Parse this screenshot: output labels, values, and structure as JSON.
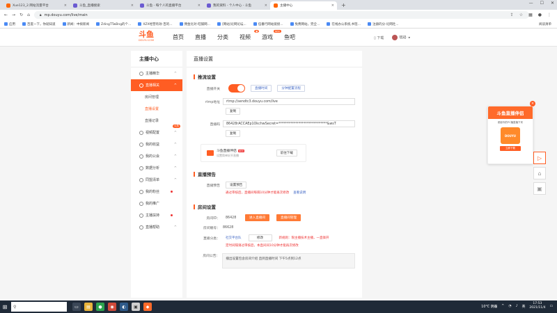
{
  "browser": {
    "tabs": [
      {
        "label": "Xue123_2.网站流量平台",
        "color": "#ff6600"
      },
      {
        "label": "斗鱼_直播搜索",
        "color": "#6b5bd1"
      },
      {
        "label": "斗鱼 - 每个人的直播平台",
        "color": "#6b5bd1"
      },
      {
        "label": "我的资料 - 个人中心 - 斗鱼",
        "color": "#6b5bd1"
      },
      {
        "label": "主播中心",
        "color": "#ff5d23"
      }
    ],
    "url": "mp.douyu.com/live/main",
    "bookmarks": [
      "应用",
      "百度一下，你就知道",
      "新闻：中搞新闻",
      "ZdingTTwBng的个...",
      "XZX经营有效-百的...",
      "佣金比对-旺铺网...",
      "[网站]论网论坛...",
      "伍番行网站链接...",
      "免费网站，完全...",
      "在线办公系统,书签...",
      "注册的分-论网社..."
    ],
    "bookmarks_right": "阅读清单"
  },
  "site": {
    "logo_main": "斗鱼",
    "logo_sub": "DOUYU.COM",
    "nav": [
      {
        "label": "首页",
        "badge": ""
      },
      {
        "label": "直播",
        "badge": ""
      },
      {
        "label": "分类",
        "badge": ""
      },
      {
        "label": "视频",
        "badge": "●"
      },
      {
        "label": "游戏",
        "badge": "NEW"
      },
      {
        "label": "鱼吧",
        "badge": ""
      }
    ],
    "download": "下载",
    "user": "明玥·"
  },
  "sidebar": {
    "title": "主播中心",
    "items": [
      {
        "label": "主播精华",
        "caret": "^"
      },
      {
        "label": "直播相关",
        "caret": "^",
        "active": true
      },
      {
        "label": "房间管理",
        "sub": true
      },
      {
        "label": "直播设置",
        "sub": true,
        "on": true
      },
      {
        "label": "直播记录",
        "sub": true
      },
      {
        "label": "视频配置",
        "caret": "^",
        "tag": "火热"
      },
      {
        "label": "我的收益",
        "caret": "^"
      },
      {
        "label": "我的公会",
        "caret": "^"
      },
      {
        "label": "数据分析",
        "caret": "^"
      },
      {
        "label": "同盟清单",
        "caret": "^"
      },
      {
        "label": "我的粉丝",
        "dot": true
      },
      {
        "label": "我的推广",
        "caret": ""
      },
      {
        "label": "主播扶持",
        "dot": true
      },
      {
        "label": "直播帮助",
        "caret": "^"
      }
    ]
  },
  "main": {
    "title": "直播设置",
    "push": {
      "heading": "推流设置",
      "switch_label": "直播开关",
      "btn_record": "直播时间",
      "btn_other": "分钟配置流程",
      "rtmp_label": "rtmp地址",
      "rtmp_value": "rtmp://sendtc3.douyu.com/live",
      "copy1": "复制",
      "code_label": "直播码",
      "code_value": "86428rACCAEp1OkchwSecret=*****************************&wsT",
      "copy2": "复制",
      "promo_title": "斗鱼直播伴侣",
      "promo_new": "NEW",
      "promo_sub": "设置简单好开直播",
      "promo_btn": "前往下载"
    },
    "notice": {
      "heading": "直播预告",
      "label": "直播预告",
      "btn": "设置预告",
      "warn": "通过审核后，直播间每隔10分钟才能再次修改",
      "link": "查看说明"
    },
    "room": {
      "heading": "房间设置",
      "id_label": "房间ID：",
      "id_value": "86428",
      "btn_enter": "进入直播间",
      "btn_manage": "直播间管理",
      "num_label": "房间靓号：",
      "num_value": "86628",
      "cate_label": "直播分类：",
      "cate_value": "社交平台队",
      "cate_btn": "修改",
      "cate_extra": "新规则：限主播技术主播，一直锋开",
      "cate_warn": "定时间隔请过审核后，本直间间10分钟才能再次修改",
      "ann_label": "房间公告：",
      "ann_value": "播出设置包含房间介绍 直到直播时间 下午5点到12点"
    }
  },
  "float_ad": {
    "title": "斗鱼直播伴侣",
    "sub": "都影你的PC播直播下来",
    "app": "DOUYU",
    "btn": "立即下载"
  },
  "taskbar": {
    "search": "",
    "weather": "10°C 阴霾",
    "lang": "英",
    "time": "17:53",
    "date": "2021/11/4"
  }
}
